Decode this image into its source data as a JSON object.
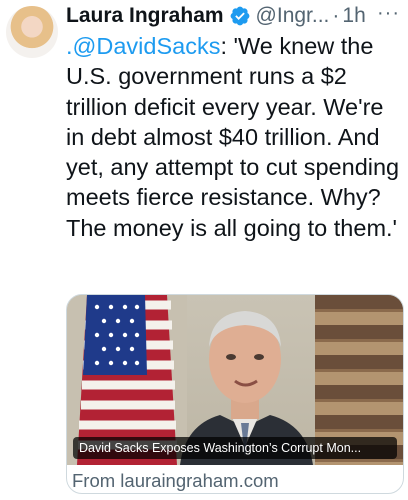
{
  "author": {
    "name": "Laura Ingraham",
    "handle": "@Ingr...",
    "separator": "·",
    "time": "1h"
  },
  "more_label": "···",
  "tweet": {
    "mention": ".@DavidSacks",
    "text": ": 'We knew the U.S. government runs a $2 trillion deficit every year. We're in debt almost $40 trillion. And yet, any attempt to cut spending meets fierce resistance. Why? The money is all going to them.'"
  },
  "card": {
    "caption": "David Sacks Exposes Washington’s Corrupt Mon...",
    "source": "From lauraingraham.com"
  },
  "colors": {
    "link": "#1d9bf0",
    "verified": "#1d9bf0",
    "secondary": "#536471"
  },
  "icons": {
    "verified": "verified-badge-icon",
    "more": "more-icon"
  }
}
